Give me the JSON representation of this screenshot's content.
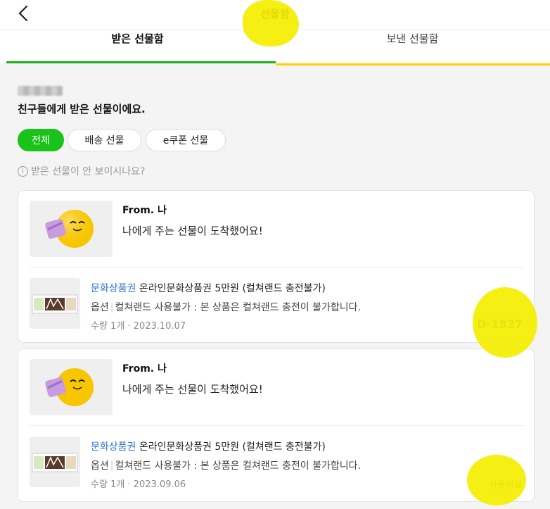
{
  "header": {
    "back_icon": "chevron-left-icon",
    "title": "선물함"
  },
  "tabs": [
    {
      "label": "받은 선물함",
      "active": true
    },
    {
      "label": "보낸 선물함",
      "active": false
    }
  ],
  "colors": {
    "active_tab": "#17b317",
    "tab_underline": "#ffd100",
    "active_chip": "#19c319",
    "brand_link": "#2b74d8",
    "highlight": "#f5ee00"
  },
  "intro": {
    "subtitle": "친구들에게 받은 선물이에요."
  },
  "filters": [
    {
      "label": "전체",
      "active": true
    },
    {
      "label": "배송 선물",
      "active": false
    },
    {
      "label": "e쿠폰 선물",
      "active": false
    }
  ],
  "hint": {
    "icon": "info-icon",
    "text": "받은 선물이 안 보이시나요?"
  },
  "gifts": [
    {
      "from_label": "From. 나",
      "message": "나에게 주는 선물이 도착했어요!",
      "brand": "문화상품권",
      "product": "온라인문화상품권 5만원 (컬쳐랜드 충전불가)",
      "option_label": "옵션",
      "option_text": "컬쳐랜드 사용불가 : 본 상품은 컬쳐랜드 충전이 불가합니다.",
      "meta": "수량 1개 · 2023.10.07",
      "status": "D-1827",
      "status_type": "dday"
    },
    {
      "from_label": "From. 나",
      "message": "나에게 주는 선물이 도착했어요!",
      "brand": "문화상품권",
      "product": "온라인문화상품권 5만원 (컬쳐랜드 충전불가)",
      "option_label": "옵션",
      "option_text": "컬쳐랜드 사용불가 : 본 상품은 컬쳐랜드 충전이 불가합니다.",
      "meta": "수량 1개 · 2023.09.06",
      "status": "사용완료",
      "status_type": "used"
    }
  ]
}
